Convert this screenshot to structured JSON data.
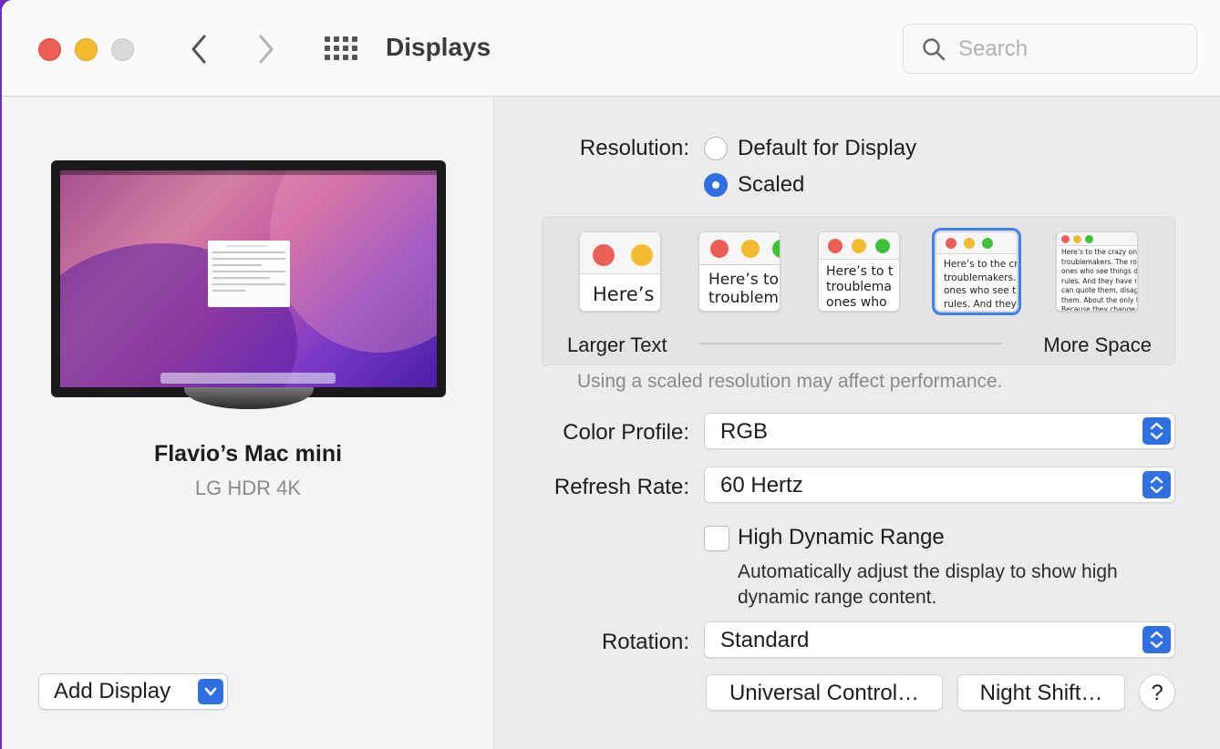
{
  "window": {
    "title": "Displays",
    "search_placeholder": "Search"
  },
  "sidebar": {
    "device_name": "Flavio’s Mac mini",
    "device_model": "LG HDR 4K",
    "add_display_label": "Add Display"
  },
  "resolution": {
    "label": "Resolution:",
    "options": [
      {
        "label": "Default for Display",
        "selected": false
      },
      {
        "label": "Scaled",
        "selected": true
      }
    ],
    "scale_options": [
      {
        "text": "Here’s",
        "selected": false
      },
      {
        "text": "Here’s to\ntroublem",
        "selected": false
      },
      {
        "text": "Here’s to t\ntroublema\nones who",
        "selected": false
      },
      {
        "text": "Here’s to the cr\ntroublemakers.\nones who see t\nrules. And they",
        "selected": true
      },
      {
        "text": "Here’s to the crazy ones\ntroublemakers. The rou\nones who see things dif\nrules. And they have no\ncan quote them, disagre\nthem. About the only th\nBecause they change th",
        "selected": false
      }
    ],
    "larger_text_label": "Larger Text",
    "more_space_label": "More Space",
    "performance_note": "Using a scaled resolution may affect performance."
  },
  "color_profile": {
    "label": "Color Profile:",
    "value": "RGB"
  },
  "refresh_rate": {
    "label": "Refresh Rate:",
    "value": "60 Hertz"
  },
  "hdr": {
    "label": "High Dynamic Range",
    "checked": false,
    "description": "Automatically adjust the display to show high dynamic range content."
  },
  "rotation": {
    "label": "Rotation:",
    "value": "Standard"
  },
  "buttons": {
    "universal_control": "Universal Control…",
    "night_shift": "Night Shift…",
    "help": "?"
  },
  "colors": {
    "accent": "#2f6fe2",
    "close": "#ec5f57",
    "minimize": "#f3bc2f",
    "zoom_disabled": "#d9d9d9",
    "desktop_background": "#6b2fb8"
  }
}
